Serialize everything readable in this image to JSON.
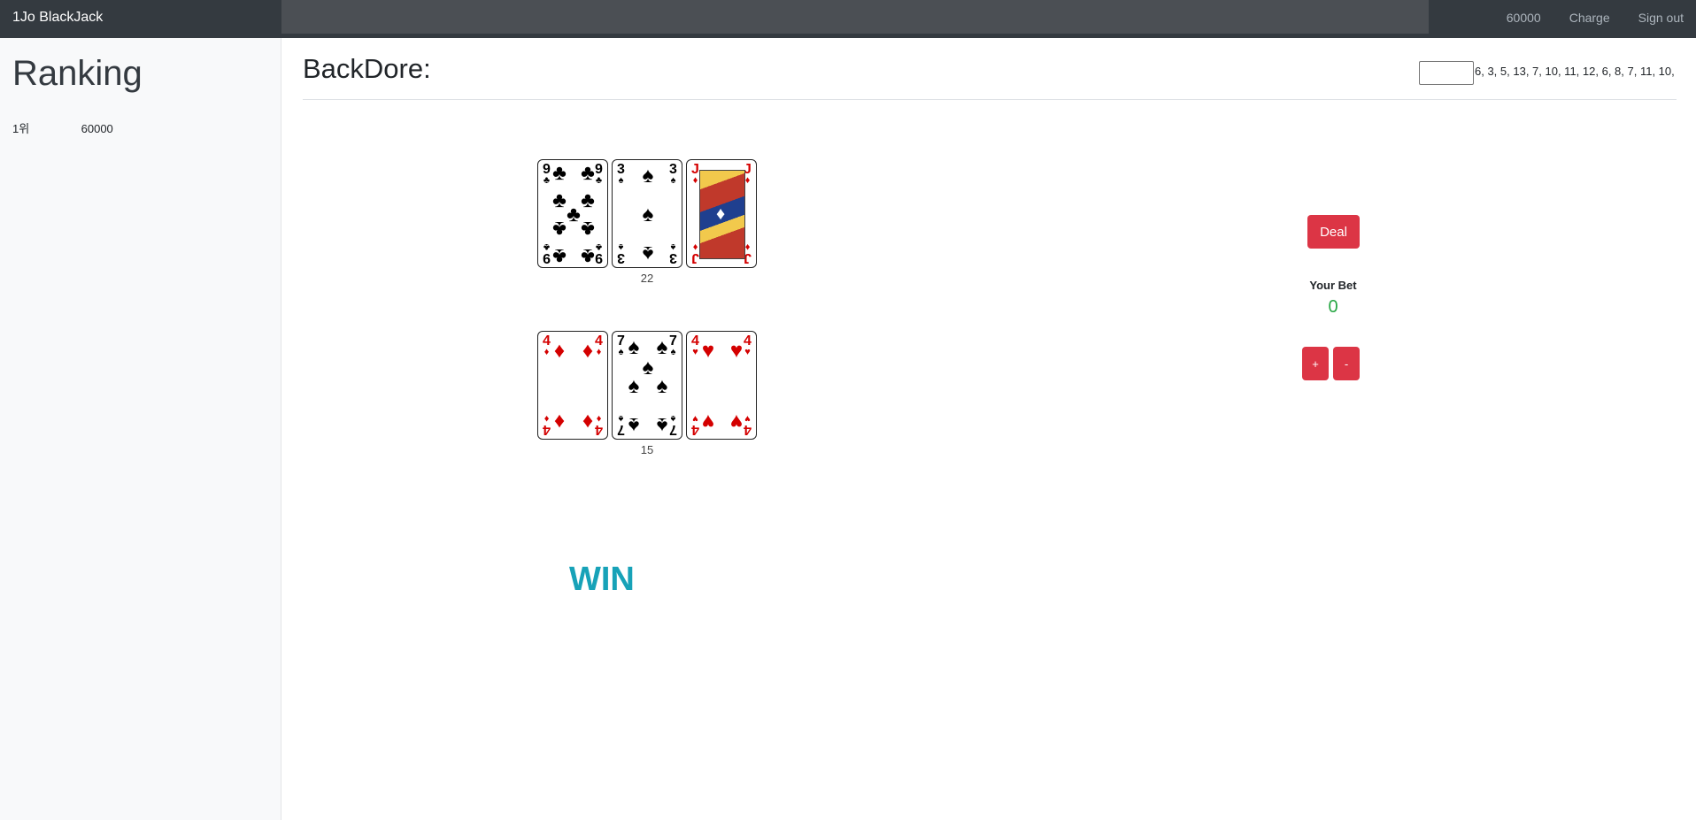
{
  "navbar": {
    "brand": "1Jo BlackJack",
    "balance": "60000",
    "charge_label": "Charge",
    "signout_label": "Sign out"
  },
  "sidebar": {
    "title": "Ranking",
    "rankings": [
      {
        "rank": "1위",
        "score": "60000"
      }
    ]
  },
  "main": {
    "title": "BackDore:",
    "backdoor_input_value": "",
    "backdoor_sequence": "6, 3, 5, 13, 7, 10, 11, 12, 6, 8, 7, 11, 10,"
  },
  "dealer_hand": {
    "cards": [
      {
        "rank": "9",
        "suit": "clubs",
        "symbol": "♣",
        "color": "#000000"
      },
      {
        "rank": "3",
        "suit": "spades",
        "symbol": "♠",
        "color": "#000000"
      },
      {
        "rank": "J",
        "suit": "diamonds",
        "symbol": "♦",
        "color": "#d40000"
      }
    ],
    "total": "22"
  },
  "player_hand": {
    "cards": [
      {
        "rank": "4",
        "suit": "diamonds",
        "symbol": "♦",
        "color": "#d40000"
      },
      {
        "rank": "7",
        "suit": "spades",
        "symbol": "♠",
        "color": "#000000"
      },
      {
        "rank": "4",
        "suit": "hearts",
        "symbol": "♥",
        "color": "#d40000"
      }
    ],
    "total": "15"
  },
  "result": {
    "text": "WIN",
    "color": "#17a2b8"
  },
  "controls": {
    "deal_label": "Deal",
    "bet_label": "Your Bet",
    "bet_value": "0",
    "plus_label": "+",
    "minus_label": "-"
  },
  "colors": {
    "navbar_bg": "#343a40",
    "danger": "#dc3545",
    "success": "#28a745",
    "info": "#17a2b8"
  }
}
